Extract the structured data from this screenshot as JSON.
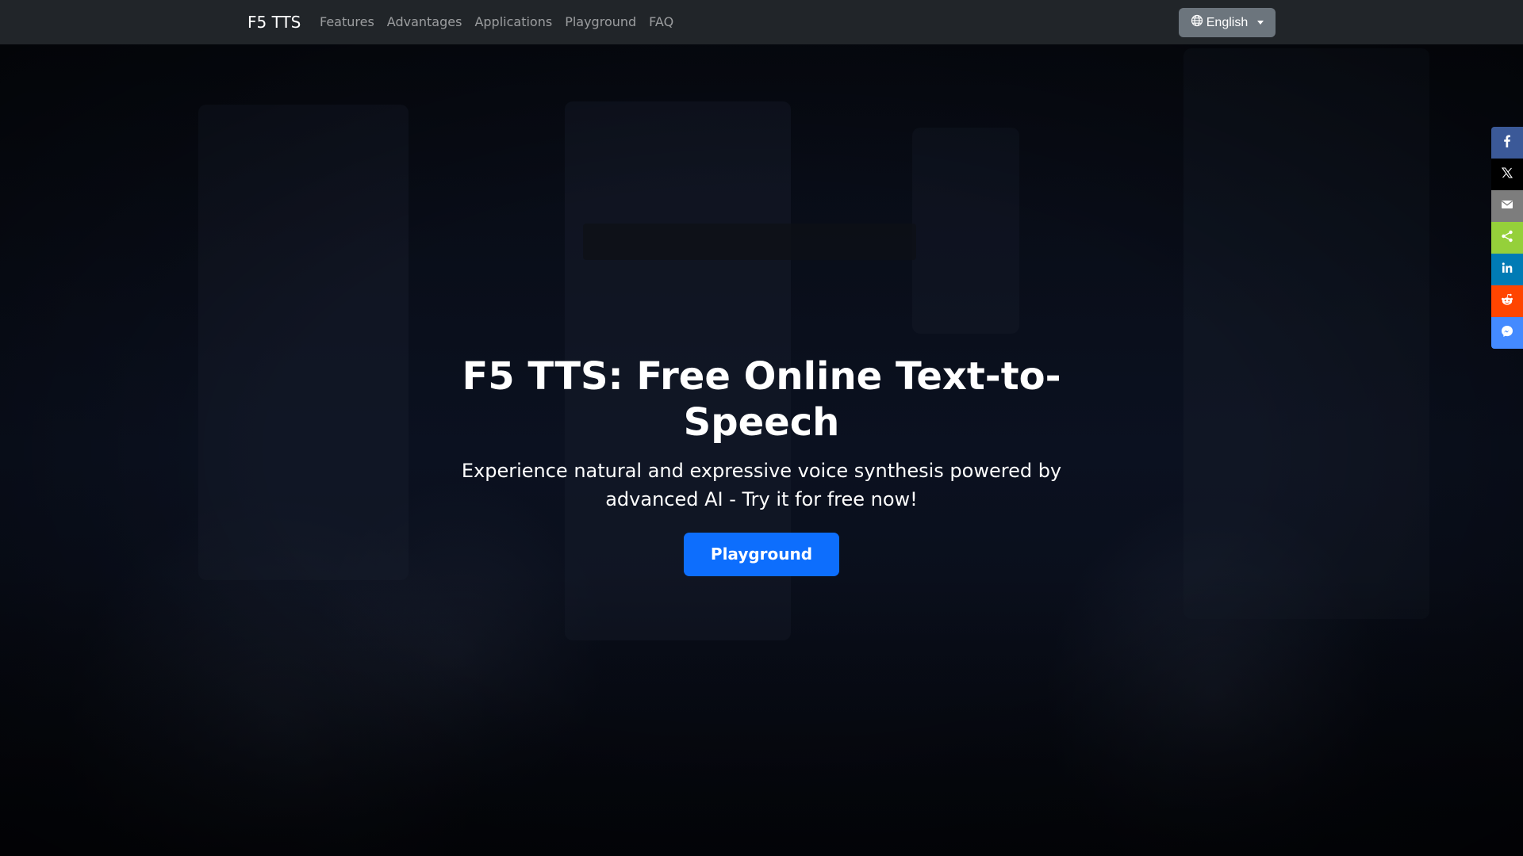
{
  "navbar": {
    "brand": "F5 TTS",
    "links": [
      "Features",
      "Advantages",
      "Applications",
      "Playground",
      "FAQ"
    ],
    "language_button": {
      "label": "English",
      "icon": "globe-icon"
    }
  },
  "hero": {
    "title": "F5 TTS: Free Online Text-to-Speech",
    "subtitle": "Experience natural and expressive voice synthesis powered by advanced AI - Try it for free now!",
    "cta_label": "Playground",
    "cta_color": "#0d6efd"
  },
  "share_bar": {
    "buttons": [
      {
        "name": "facebook",
        "icon": "facebook-icon",
        "color": "#3b5998"
      },
      {
        "name": "x",
        "icon": "x-icon",
        "color": "#000000"
      },
      {
        "name": "email",
        "icon": "email-icon",
        "color": "#7d7d7d"
      },
      {
        "name": "share",
        "icon": "share-icon",
        "color": "#95d03a"
      },
      {
        "name": "linkedin",
        "icon": "linkedin-icon",
        "color": "#007bb5"
      },
      {
        "name": "reddit",
        "icon": "reddit-icon",
        "color": "#ff4500"
      },
      {
        "name": "messenger",
        "icon": "messenger-icon",
        "color": "#448aff"
      }
    ]
  },
  "colors": {
    "navbar_bg": "#212529",
    "language_button_bg": "#6c757d",
    "primary": "#0d6efd"
  }
}
